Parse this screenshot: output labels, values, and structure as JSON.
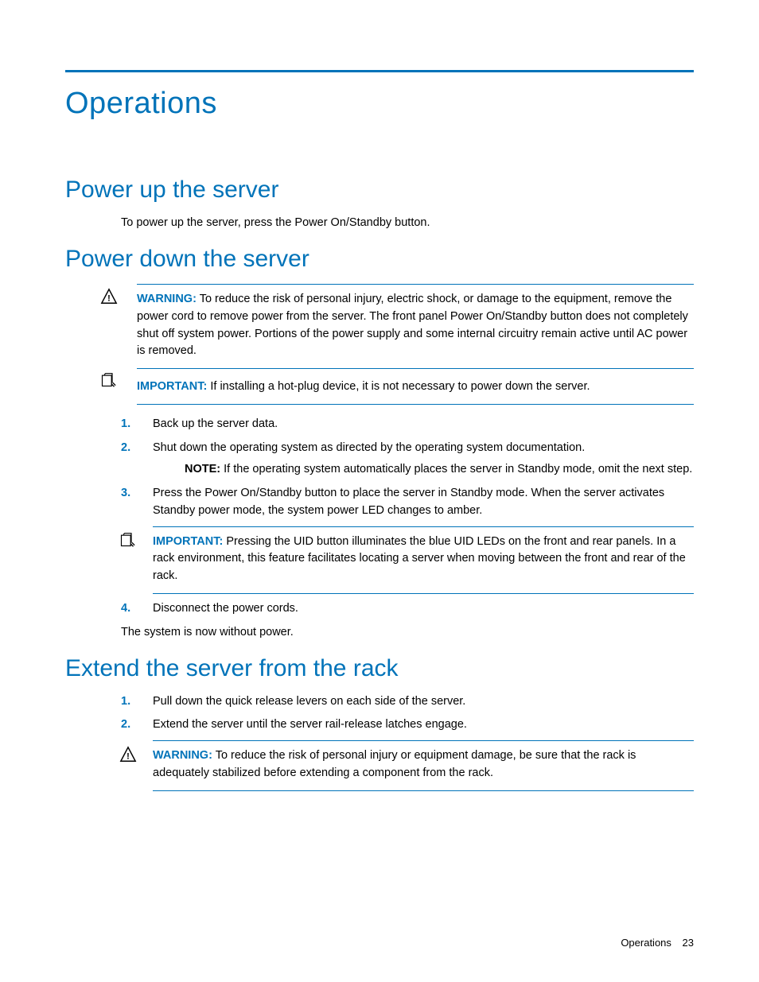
{
  "chapter_title": "Operations",
  "sections": {
    "power_up": {
      "heading": "Power up the server",
      "body": "To power up the server, press the Power On/Standby button."
    },
    "power_down": {
      "heading": "Power down the server",
      "warning": {
        "label": "WARNING:",
        "text": "To reduce the risk of personal injury, electric shock, or damage to the equipment, remove the power cord to remove power from the server. The front panel Power On/Standby button does not completely shut off system power. Portions of the power supply and some internal circuitry remain active until AC power is removed."
      },
      "important": {
        "label": "IMPORTANT:",
        "text": "If installing a hot-plug device, it is not necessary to power down the server."
      },
      "steps": [
        {
          "n": "1.",
          "text": "Back up the server data."
        },
        {
          "n": "2.",
          "text": "Shut down the operating system as directed by the operating system documentation.",
          "note": {
            "label": "NOTE:",
            "text": "If the operating system automatically places the server in Standby mode, omit the next step."
          }
        },
        {
          "n": "3.",
          "text": "Press the Power On/Standby button to place the server in Standby mode. When the server activates Standby power mode, the system power LED changes to amber.",
          "important": {
            "label": "IMPORTANT:",
            "text": "Pressing the UID button illuminates the blue UID LEDs on the front and rear panels. In a rack environment, this feature facilitates locating a server when moving between the front and rear of the rack."
          }
        },
        {
          "n": "4.",
          "text": "Disconnect the power cords."
        }
      ],
      "closing": "The system is now without power."
    },
    "extend": {
      "heading": "Extend the server from the rack",
      "steps": [
        {
          "n": "1.",
          "text": "Pull down the quick release levers on each side of the server."
        },
        {
          "n": "2.",
          "text": "Extend the server until the server rail-release latches engage.",
          "warning": {
            "label": "WARNING:",
            "text": "To reduce the risk of personal injury or equipment damage, be sure that the rack is adequately stabilized before extending a component from the rack."
          }
        }
      ]
    }
  },
  "footer": {
    "section": "Operations",
    "page": "23"
  }
}
